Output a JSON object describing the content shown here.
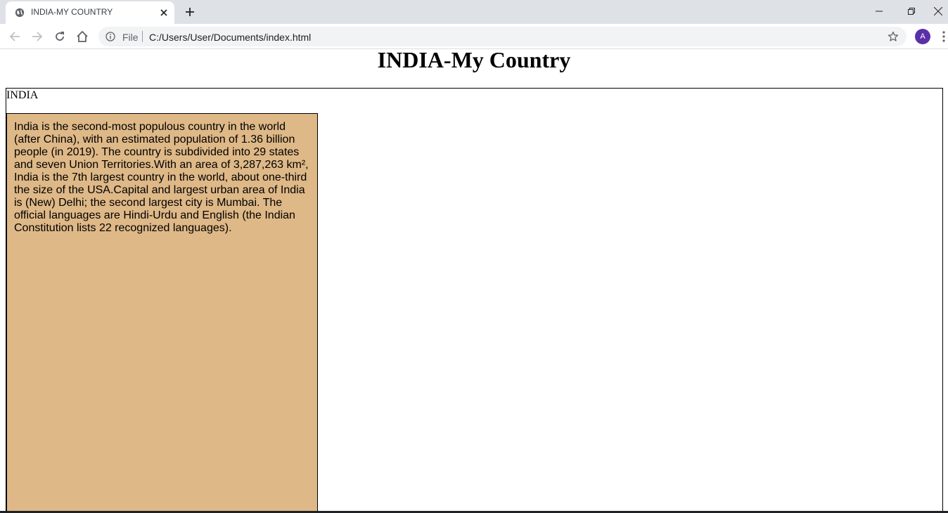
{
  "browser": {
    "tab_title": "INDIA-MY COUNTRY",
    "address_scheme": "File",
    "address_url": "C:/Users/User/Documents/index.html",
    "profile_initial": "A",
    "profile_color": "#5b2fa8"
  },
  "page": {
    "heading": "INDIA-My Country",
    "frame_label": "INDIA",
    "info_paragraph": "India is the second-most populous country in the world (after China), with an estimated population of 1.36 billion people (in 2019). The country is subdivided into 29 states and seven Union Territories.With an area of 3,287,263 km², India is the 7th largest country in the world, about one-third the size of the USA.Capital and largest urban area of India is (New) Delhi; the second largest city is Mumbai. The official languages are Hindi-Urdu and English (the Indian Constitution lists 22 recognized languages).",
    "info_box_color": "#deb887"
  }
}
